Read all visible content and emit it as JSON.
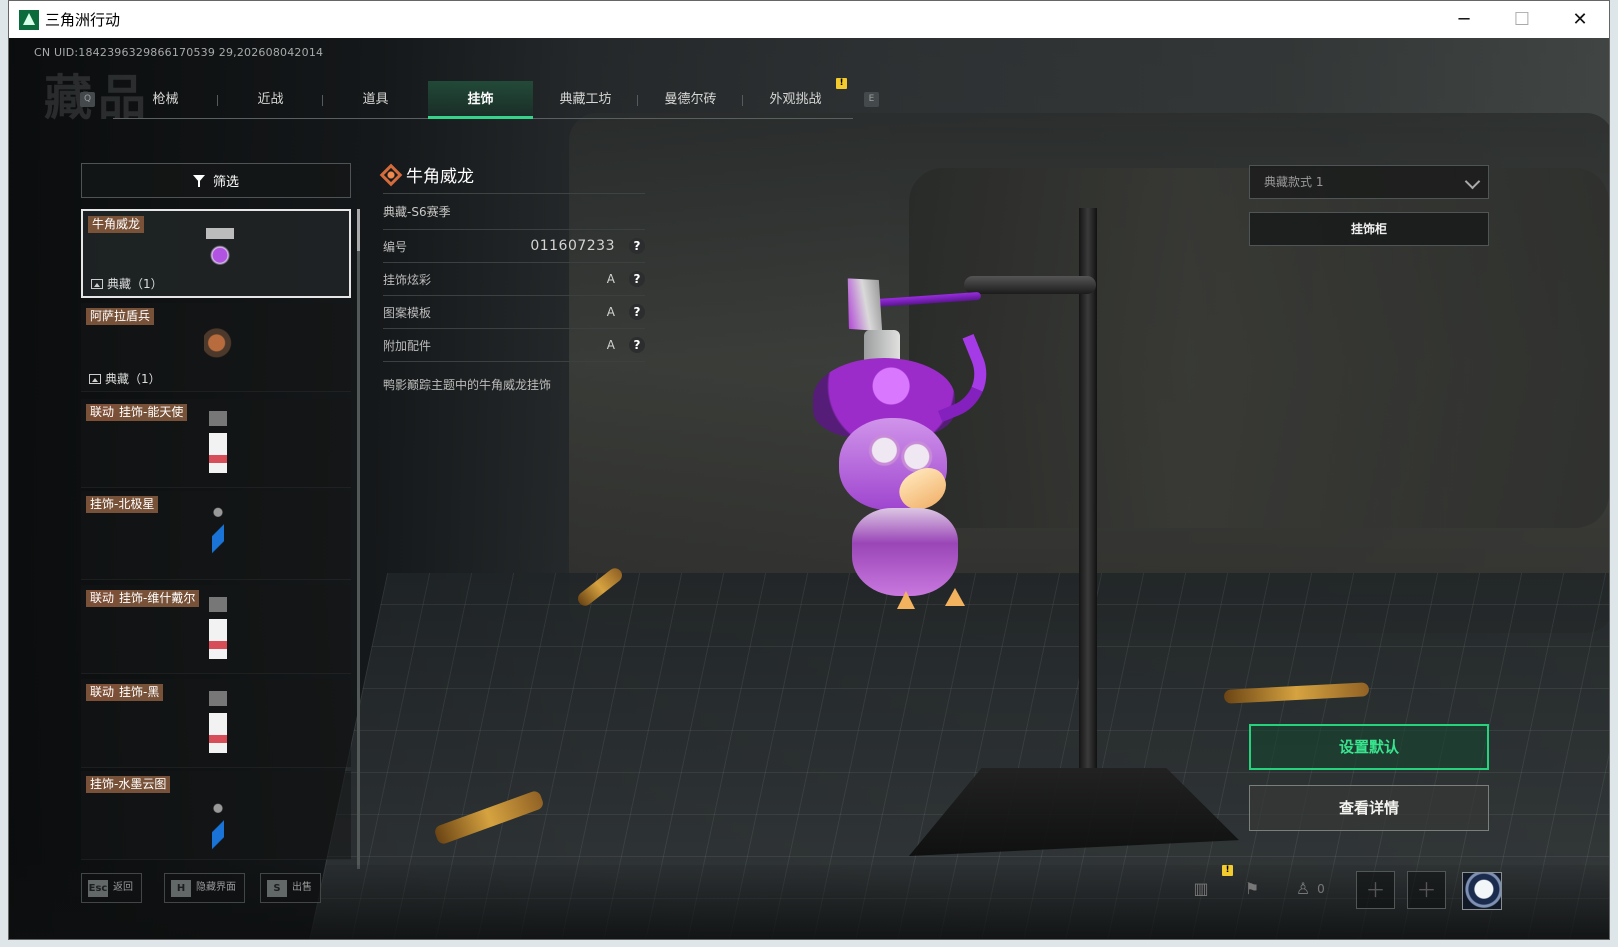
{
  "window": {
    "title": "三角洲行动",
    "controls": [
      "─",
      "☐",
      "✕"
    ]
  },
  "header": {
    "uid": "CN UID:1842396329866170539 29,202608042014",
    "ghost_title": "藏品",
    "left_key": "Q",
    "right_key": "E",
    "alert": "!"
  },
  "tabs": [
    {
      "label": "枪械"
    },
    {
      "label": "近战"
    },
    {
      "label": "道具"
    },
    {
      "label": "挂饰"
    },
    {
      "label": "典藏工坊"
    },
    {
      "label": "曼德尔砖"
    },
    {
      "label": "外观挑战"
    }
  ],
  "filter": {
    "label": "筛选"
  },
  "items": [
    {
      "tag": "牛角威龙",
      "collab": "",
      "sub": "典藏（1）"
    },
    {
      "tag": "阿萨拉盾兵",
      "collab": "",
      "sub": "典藏（1）"
    },
    {
      "tag": "挂饰-能天使",
      "collab": "联动",
      "sub": ""
    },
    {
      "tag": "挂饰-北极星",
      "collab": "",
      "sub": ""
    },
    {
      "tag": "挂饰-维什戴尔",
      "collab": "联动",
      "sub": ""
    },
    {
      "tag": "挂饰-黑",
      "collab": "联动",
      "sub": ""
    },
    {
      "tag": "挂饰-水墨云图",
      "collab": "",
      "sub": ""
    }
  ],
  "detail": {
    "title": "牛角威龙",
    "season": "典藏-S6赛季",
    "rows": [
      {
        "label": "编号",
        "value": "011607233",
        "help": "?"
      },
      {
        "label": "挂饰炫彩",
        "value": "A",
        "help": "?"
      },
      {
        "label": "图案模板",
        "value": "A",
        "help": "?"
      },
      {
        "label": "附加配件",
        "value": "A",
        "help": "?"
      }
    ],
    "description": "鸭影巅踪主题中的牛角威龙挂饰"
  },
  "right_panel": {
    "skin_select": "典藏款式 1",
    "cabinet_button": "挂饰柜",
    "set_default_button": "设置默认",
    "view_detail_button": "查看详情"
  },
  "bottom": {
    "hotkeys": [
      {
        "key": "Esc",
        "label": "返回"
      },
      {
        "key": "H",
        "label": "隐藏界面"
      },
      {
        "key": "S",
        "label": "出售"
      }
    ],
    "friends_count": "0",
    "alert": "!"
  },
  "colors": {
    "accent_green": "#36d48b",
    "tag_brown": "#7e553a",
    "alert_yellow": "#f3cb2f"
  }
}
